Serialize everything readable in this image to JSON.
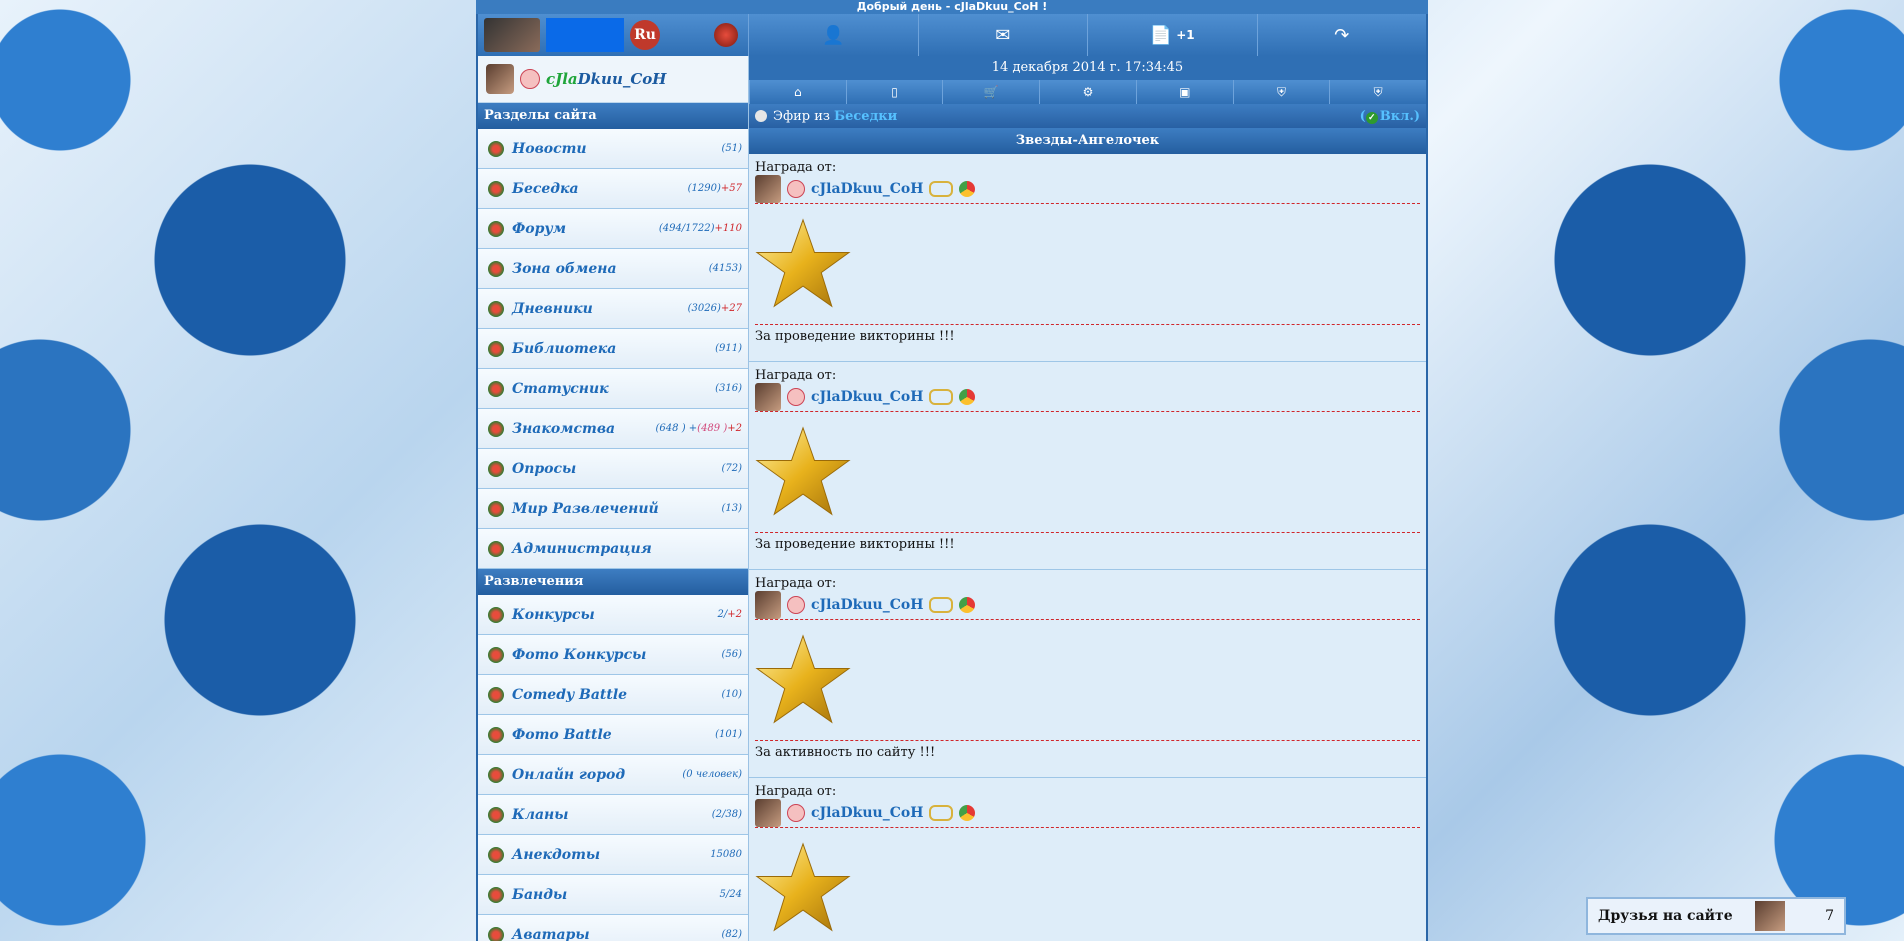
{
  "greeting": "Добрый день - cJlaDkuu_CoH !",
  "header": {
    "logo_text": "Ru",
    "notify_badge": "+1"
  },
  "user": {
    "nick_green": "cJla",
    "nick_rest": "Dkuu_CoH"
  },
  "datetime": "14 декабря 2014 г.   17:34:45",
  "sections_title": "Разделы сайта",
  "sections": [
    {
      "label": "Новости",
      "count": "(51)",
      "extra": ""
    },
    {
      "label": "Беседка",
      "count": "(1290)",
      "extra": "+57"
    },
    {
      "label": "Форум",
      "count": "(494/1722)",
      "extra": "+110"
    },
    {
      "label": "Зона обмена",
      "count": "(4153)",
      "extra": ""
    },
    {
      "label": "Дневники",
      "count": "(3026)",
      "extra": "+27"
    },
    {
      "label": "Библиотека",
      "count": "(911)",
      "extra": ""
    },
    {
      "label": "Статусник",
      "count": "(316)",
      "extra": ""
    },
    {
      "label": "Знакомства",
      "count": "(648 ) +",
      "pink": "(489 )",
      "extra": "+2"
    },
    {
      "label": "Опросы",
      "count": "(72)",
      "extra": ""
    },
    {
      "label": "Мир Развлечений",
      "count": "(13)",
      "extra": ""
    },
    {
      "label": "Администрация",
      "count": "",
      "extra": ""
    }
  ],
  "fun_title": "Развлечения",
  "fun": [
    {
      "label": "Конкурсы",
      "count": "2/",
      "extra": "+2"
    },
    {
      "label": "Фото Конкурсы",
      "count": "(56)",
      "extra": ""
    },
    {
      "label": "Comedy Battle",
      "count": "(10)",
      "extra": ""
    },
    {
      "label": "Фото Battle",
      "count": "(101)",
      "extra": ""
    },
    {
      "label": "Онлайн город",
      "count": "(0 человек)",
      "extra": ""
    },
    {
      "label": "Кланы",
      "count": "(2/38)",
      "extra": ""
    },
    {
      "label": "Анекдоты",
      "count": "15080",
      "extra": ""
    },
    {
      "label": "Банды",
      "count": "5/24",
      "extra": ""
    },
    {
      "label": "Аватары",
      "count": "(82)",
      "extra": ""
    }
  ],
  "efir": {
    "prefix": "Эфир из",
    "link": "Беседки",
    "toggle": "Вкл.)"
  },
  "page_title": "Звезды-Ангелочек",
  "award_from_label": "Награда от:",
  "awards": [
    {
      "name": "cJlaDkuu_CoH",
      "reason": "За проведение викторины !!!"
    },
    {
      "name": "cJlaDkuu_CoH",
      "reason": "За проведение викторины !!!"
    },
    {
      "name": "cJlaDkuu_CoH",
      "reason": "За активность по сайту !!!"
    },
    {
      "name": "cJlaDkuu_CoH",
      "reason": ""
    }
  ],
  "friends": {
    "label": "Друзья на сайте",
    "count": "7"
  }
}
